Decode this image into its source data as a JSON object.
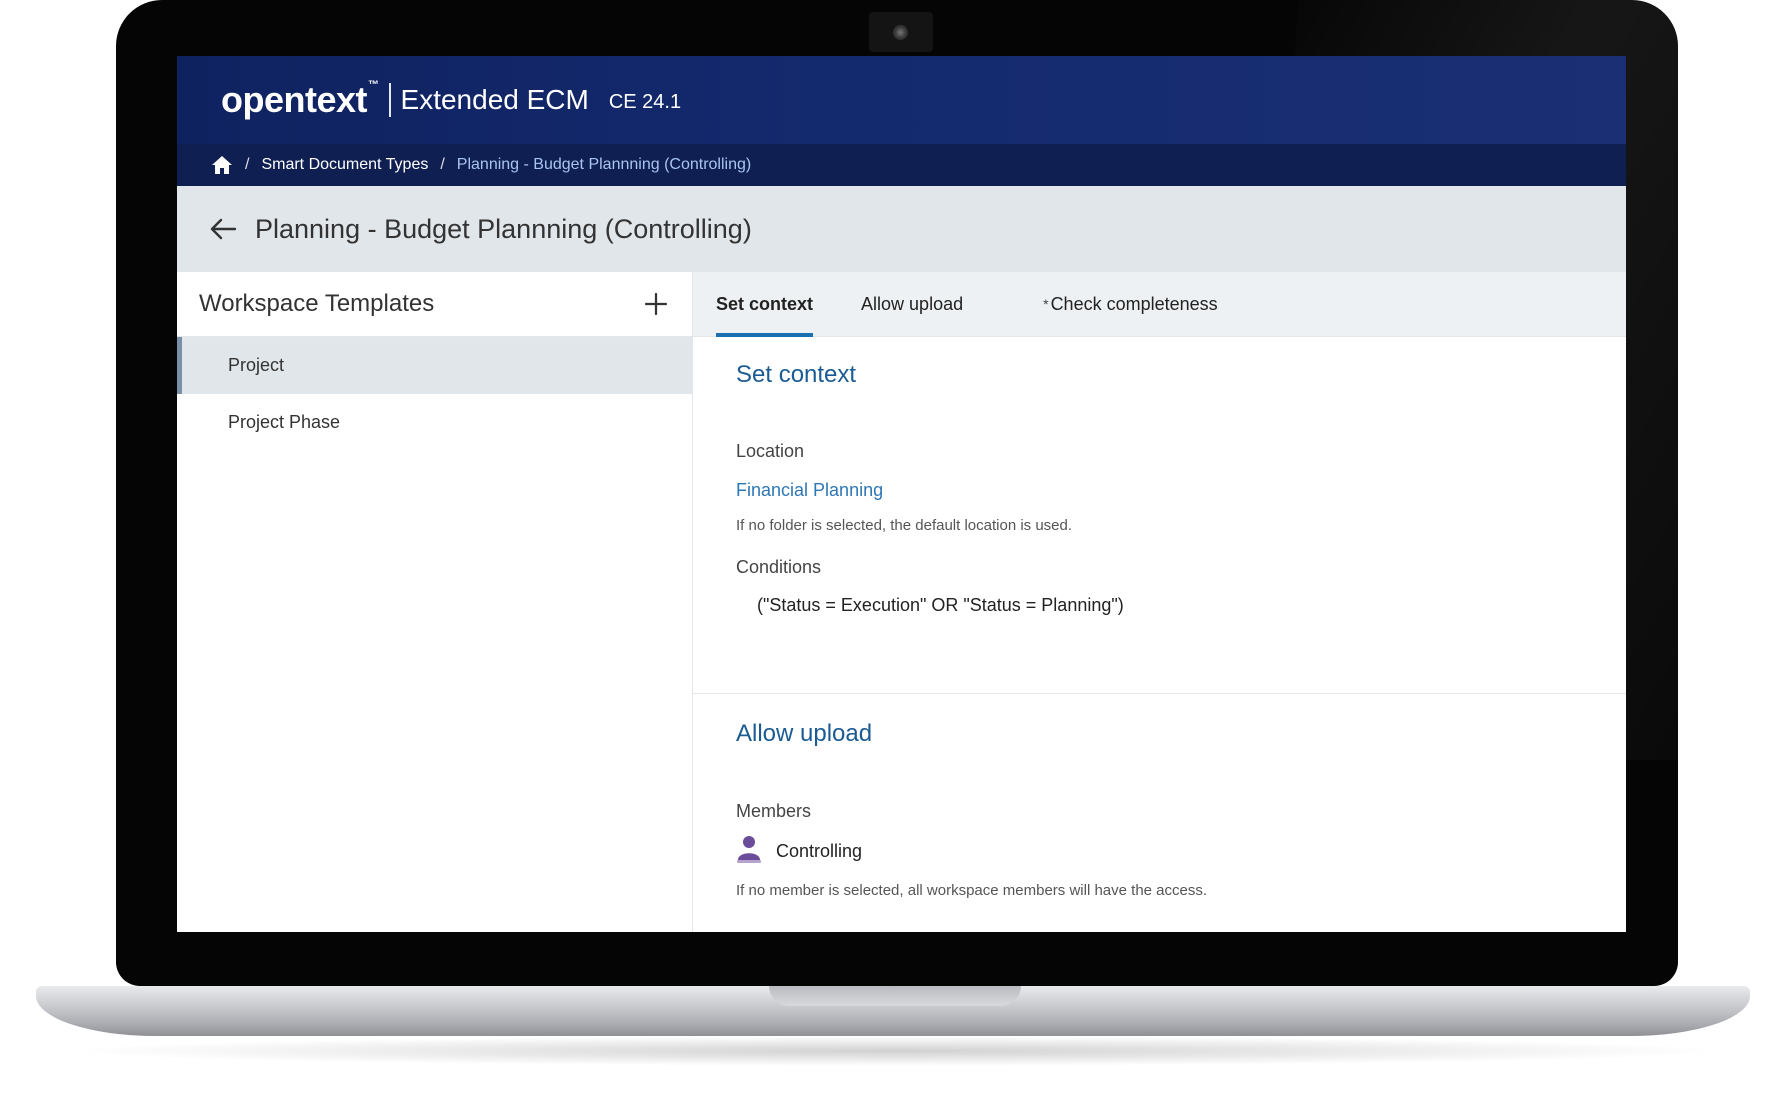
{
  "masthead": {
    "logo": "opentext",
    "trademark": "™",
    "product": "Extended ECM",
    "version": "CE 24.1"
  },
  "breadcrumb": {
    "separator": "/",
    "items": [
      "Smart Document Types",
      "Planning - Budget Plannning (Controlling)"
    ]
  },
  "page": {
    "title": "Planning - Budget Plannning (Controlling)"
  },
  "left_pane": {
    "title": "Workspace Templates",
    "items": [
      {
        "label": "Project",
        "selected": true
      },
      {
        "label": "Project Phase",
        "selected": false
      }
    ]
  },
  "tabs": [
    {
      "label": "Set context",
      "active": true,
      "required": false
    },
    {
      "label": "Allow upload",
      "active": false,
      "required": false
    },
    {
      "label": "Check completeness",
      "active": false,
      "required": true,
      "marker": "*"
    }
  ],
  "set_context": {
    "title": "Set context",
    "location_label": "Location",
    "location_value": "Financial Planning",
    "location_hint": "If no folder is selected, the default location is used.",
    "conditions_label": "Conditions",
    "conditions_value": "(\"Status = Execution\" OR \"Status = Planning\")"
  },
  "allow_upload": {
    "title": "Allow upload",
    "members_label": "Members",
    "member_name": "Controlling",
    "members_hint": "If no member is selected, all workspace members will have the access."
  },
  "colors": {
    "masthead": "#142a6e",
    "breadcrumb_bar": "#0f1f52",
    "accent": "#1b6fb1",
    "link": "#2e77b5",
    "member_icon": "#6b4c9a"
  },
  "icons": [
    "home-icon",
    "back-arrow-icon",
    "plus-icon",
    "user-icon"
  ]
}
